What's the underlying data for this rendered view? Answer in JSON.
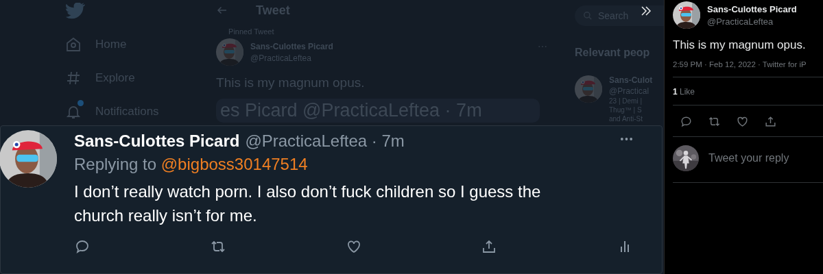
{
  "background_page": {
    "nav": [
      {
        "label": "Home",
        "kind": "home",
        "badge": false
      },
      {
        "label": "Explore",
        "kind": "explore",
        "badge": false
      },
      {
        "label": "Notifications",
        "kind": "bell",
        "badge": true
      }
    ],
    "header": {
      "title": "Tweet"
    },
    "pinned_label": "Pinned Tweet",
    "tweet": {
      "name": "Sans-Culottes Picard",
      "handle": "@PracticaLeftea",
      "text": "This is my magnum opus."
    },
    "enlarged_line": "es Picard @PracticaLeftea · 7m",
    "search": {
      "placeholder": "Search"
    },
    "relevant": {
      "title": "Relevant peop",
      "name": "Sans-Culot",
      "handle": "@Practical",
      "bio": [
        "23 | Demi |",
        "Thug™ | S",
        "and Anti-St"
      ]
    }
  },
  "reply_card": {
    "name": "Sans-Culottes Picard",
    "byline": "@PracticaLeftea · 7m",
    "replying_prefix": "Replying to",
    "mention": "@bigboss30147514",
    "text": "I don’t really watch porn. I also don’t fuck children so I guess the church really isn’t for me.",
    "actions": [
      {
        "kind": "reply"
      },
      {
        "kind": "retweet"
      },
      {
        "kind": "like"
      },
      {
        "kind": "share"
      },
      {
        "kind": "analytics"
      }
    ]
  },
  "detail_panel": {
    "name": "Sans-Culottes Picard",
    "handle": "@PracticaLeftea",
    "text": "This is my magnum opus.",
    "meta": "2:59 PM · Feb 12, 2022 · Twitter for iP",
    "likes_count": "1",
    "likes_label": "Like",
    "actions": [
      {
        "kind": "reply"
      },
      {
        "kind": "retweet"
      },
      {
        "kind": "like"
      },
      {
        "kind": "share"
      }
    ],
    "reply_placeholder": "Tweet your reply"
  }
}
